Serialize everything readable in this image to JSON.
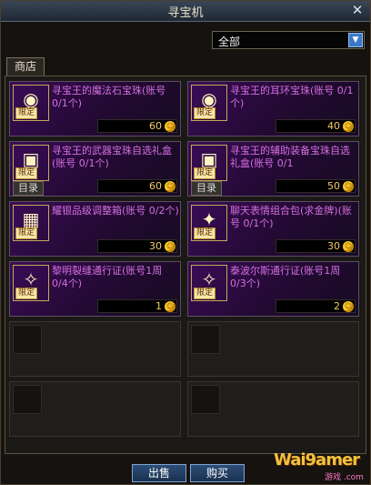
{
  "window": {
    "title": "寻宝机",
    "close_icon": "close-icon"
  },
  "filter": {
    "value": "全部",
    "dropdown_icon": "chevron-down-icon"
  },
  "tabs": [
    {
      "label": "商店"
    }
  ],
  "items": [
    {
      "name": "寻宝王的魔法石宝珠(账号 0/1个)",
      "price": "60",
      "badge": "限定",
      "icon": "orb-icon"
    },
    {
      "name": "寻宝王的耳环宝珠(账号 0/1个)",
      "price": "40",
      "badge": "限定",
      "icon": "orb-icon"
    },
    {
      "name": "寻宝王的武器宝珠自选礼盒(账号 0/1个)",
      "price": "60",
      "badge": "限定",
      "icon": "gift-box-icon",
      "catalog": "目录"
    },
    {
      "name": "寻宝王的辅助装备宝珠自选礼盒(账号 0/1",
      "price": "50",
      "badge": "限定",
      "icon": "gift-box-icon",
      "catalog": "目录"
    },
    {
      "name": "耀银品级调整箱(账号 0/2个)",
      "price": "30",
      "badge": "限定",
      "icon": "box-icon"
    },
    {
      "name": "聊天表情组合包(求金牌)(账号 0/1个)",
      "price": "30",
      "badge": "限定",
      "icon": "chat-pack-icon"
    },
    {
      "name": "黎明裂缝通行证(账号1周 0/4个)",
      "price": "1",
      "badge": "限定",
      "icon": "pass-icon"
    },
    {
      "name": "泰波尔斯通行证(账号1周 0/3个)",
      "price": "2",
      "badge": "限定",
      "icon": "pass-icon"
    }
  ],
  "buttons": {
    "sell": "出售",
    "buy": "购买"
  },
  "watermark": {
    "brand": "Wai9amer",
    "sub": "游戏 .com"
  }
}
